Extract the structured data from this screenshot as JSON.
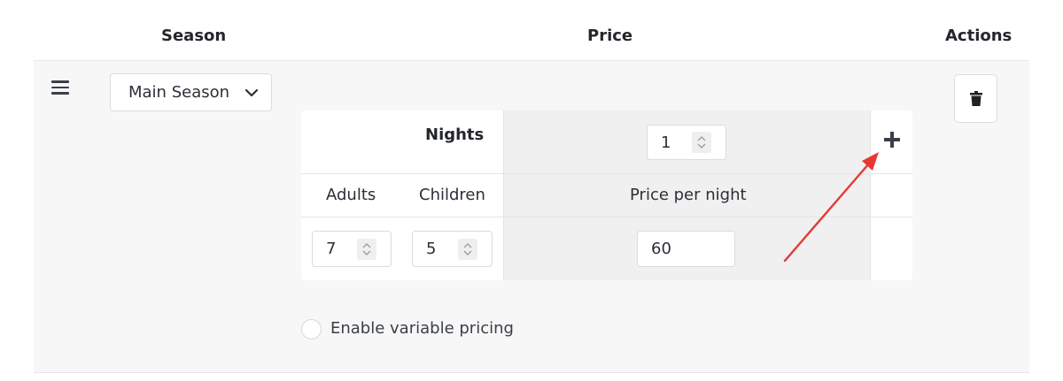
{
  "columns": {
    "season": "Season",
    "price": "Price",
    "actions": "Actions"
  },
  "season_select": {
    "value": "Main Season"
  },
  "pricing_table": {
    "nights_label": "Nights",
    "nights_value": "1",
    "adults_label": "Adults",
    "children_label": "Children",
    "price_per_night_label": "Price per night",
    "adults_value": "7",
    "children_value": "5",
    "price_value": "60"
  },
  "variable_pricing": {
    "label": "Enable variable pricing",
    "checked": false
  },
  "colors": {
    "arrow": "#e53935",
    "shade": "#f0f0f0",
    "panel": "#f7f7f7"
  },
  "icons": [
    "drag-handle-icon",
    "chevron-down-icon",
    "trash-icon",
    "plus-icon",
    "spinner-icon"
  ]
}
